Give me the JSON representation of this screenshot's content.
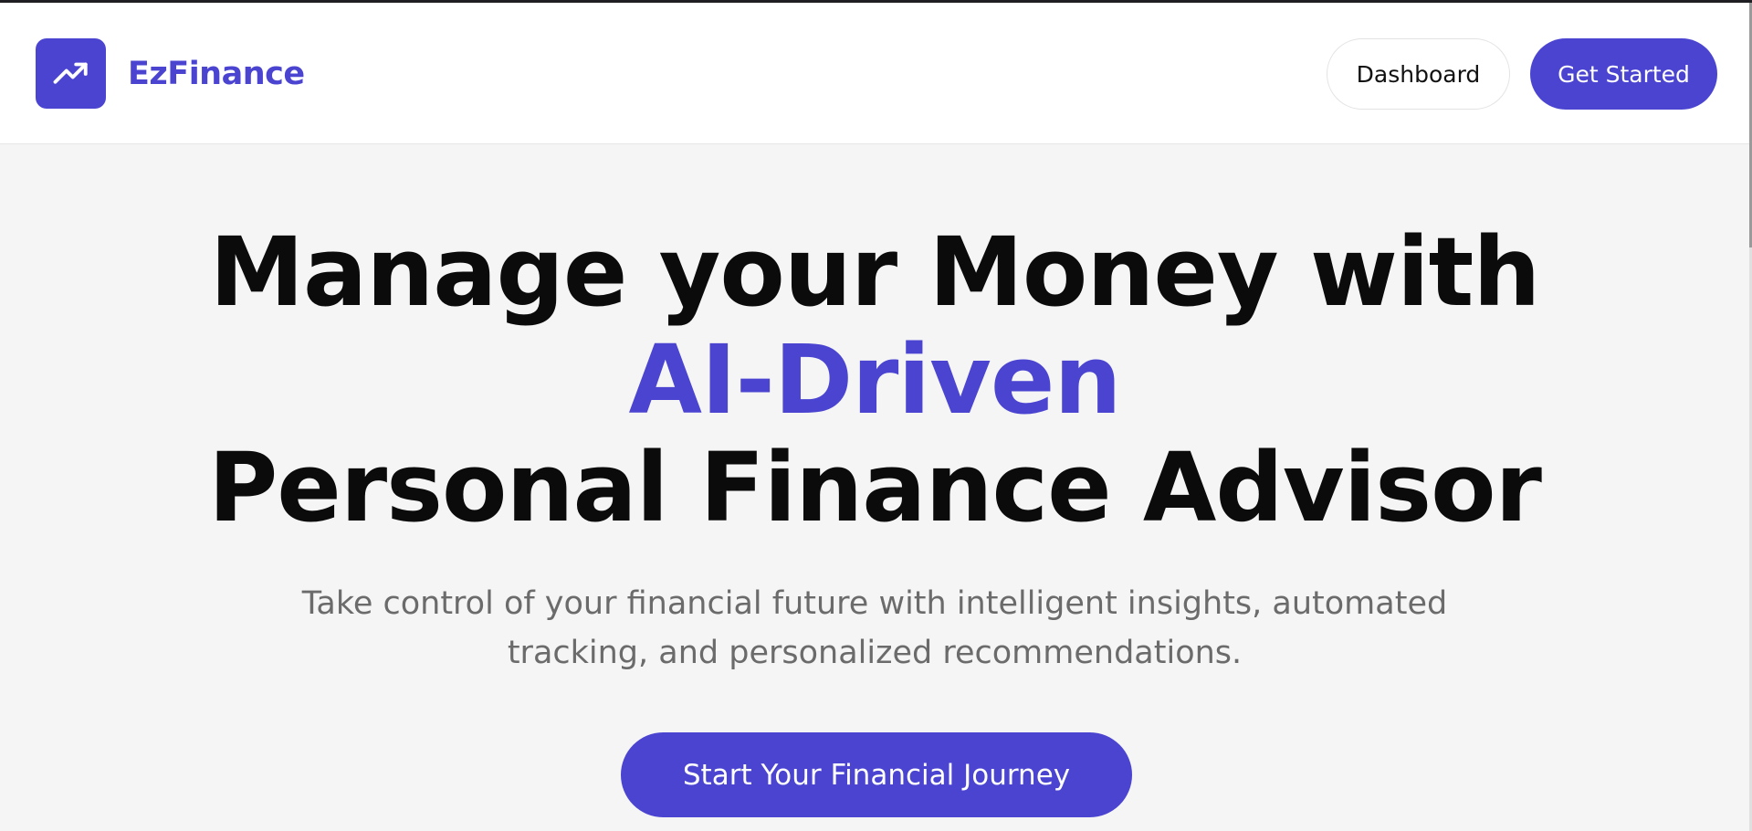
{
  "brand": {
    "name": "EzFinance",
    "icon": "trending-up-icon",
    "color": "#4a44d1"
  },
  "nav": {
    "dashboard_label": "Dashboard",
    "get_started_label": "Get Started"
  },
  "hero": {
    "title_line1": "Manage your Money with ",
    "title_accent": "AI-Driven",
    "title_line3": "Personal Finance Advisor",
    "subtitle": "Take control of your financial future with intelligent insights, automated tracking, and personalized recommendations.",
    "cta_label": "Start Your Financial Journey"
  },
  "colors": {
    "accent": "#4a44d1",
    "background": "#f5f5f5",
    "navbar": "#ffffff"
  }
}
